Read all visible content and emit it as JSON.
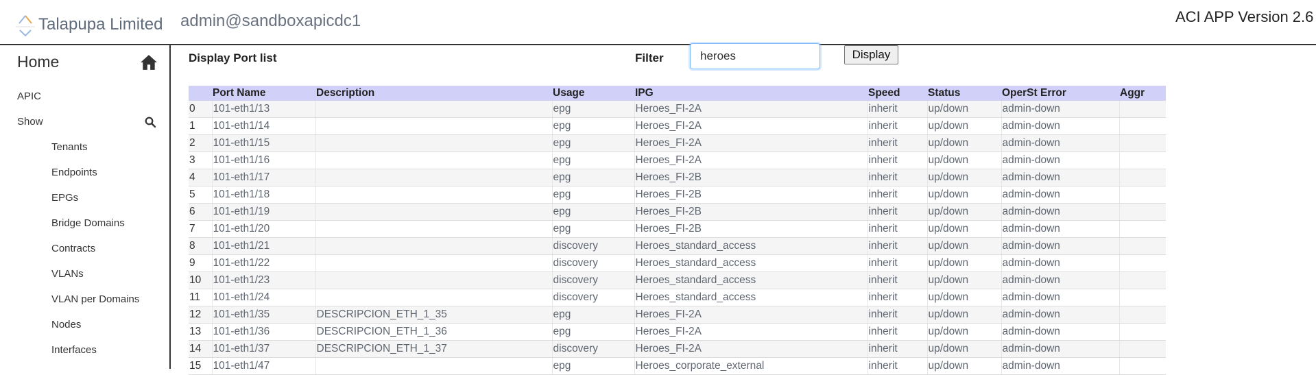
{
  "header": {
    "brand": "Talapupa Limited",
    "user": "admin@sandboxapicdc1",
    "version": "ACI APP Version 2.6"
  },
  "sidebar": {
    "home_label": "Home",
    "home_icon": "home-icon",
    "apic_label": "APIC",
    "show_label": "Show",
    "search_icon": "search-icon",
    "items": [
      "Tenants",
      "Endpoints",
      "EPGs",
      "Bridge Domains",
      "Contracts",
      "VLANs",
      "VLAN per Domains",
      "Nodes",
      "Interfaces"
    ]
  },
  "main": {
    "title": "Display Port list",
    "filter_label": "Filter",
    "filter_value": "heroes",
    "display_button": "Display",
    "columns": [
      "",
      "Port Name",
      "Description",
      "Usage",
      "IPG",
      "Speed",
      "Status",
      "OperSt Error",
      "Aggr"
    ],
    "rows": [
      [
        "0",
        "101-eth1/13",
        "",
        "epg",
        "Heroes_FI-2A",
        "inherit",
        "up/down",
        "admin-down",
        ""
      ],
      [
        "1",
        "101-eth1/14",
        "",
        "epg",
        "Heroes_FI-2A",
        "inherit",
        "up/down",
        "admin-down",
        ""
      ],
      [
        "2",
        "101-eth1/15",
        "",
        "epg",
        "Heroes_FI-2A",
        "inherit",
        "up/down",
        "admin-down",
        ""
      ],
      [
        "3",
        "101-eth1/16",
        "",
        "epg",
        "Heroes_FI-2A",
        "inherit",
        "up/down",
        "admin-down",
        ""
      ],
      [
        "4",
        "101-eth1/17",
        "",
        "epg",
        "Heroes_FI-2B",
        "inherit",
        "up/down",
        "admin-down",
        ""
      ],
      [
        "5",
        "101-eth1/18",
        "",
        "epg",
        "Heroes_FI-2B",
        "inherit",
        "up/down",
        "admin-down",
        ""
      ],
      [
        "6",
        "101-eth1/19",
        "",
        "epg",
        "Heroes_FI-2B",
        "inherit",
        "up/down",
        "admin-down",
        ""
      ],
      [
        "7",
        "101-eth1/20",
        "",
        "epg",
        "Heroes_FI-2B",
        "inherit",
        "up/down",
        "admin-down",
        ""
      ],
      [
        "8",
        "101-eth1/21",
        "",
        "discovery",
        "Heroes_standard_access",
        "inherit",
        "up/down",
        "admin-down",
        ""
      ],
      [
        "9",
        "101-eth1/22",
        "",
        "discovery",
        "Heroes_standard_access",
        "inherit",
        "up/down",
        "admin-down",
        ""
      ],
      [
        "10",
        "101-eth1/23",
        "",
        "discovery",
        "Heroes_standard_access",
        "inherit",
        "up/down",
        "admin-down",
        ""
      ],
      [
        "11",
        "101-eth1/24",
        "",
        "discovery",
        "Heroes_standard_access",
        "inherit",
        "up/down",
        "admin-down",
        ""
      ],
      [
        "12",
        "101-eth1/35",
        "DESCRIPCION_ETH_1_35",
        "epg",
        "Heroes_FI-2A",
        "inherit",
        "up/down",
        "admin-down",
        ""
      ],
      [
        "13",
        "101-eth1/36",
        "DESCRIPCION_ETH_1_36",
        "epg",
        "Heroes_FI-2A",
        "inherit",
        "up/down",
        "admin-down",
        ""
      ],
      [
        "14",
        "101-eth1/37",
        "DESCRIPCION_ETH_1_37",
        "discovery",
        "Heroes_FI-2A",
        "inherit",
        "up/down",
        "admin-down",
        ""
      ],
      [
        "15",
        "101-eth1/47",
        "",
        "epg",
        "Heroes_corporate_external",
        "inherit",
        "up/down",
        "admin-down",
        ""
      ]
    ]
  },
  "colors": {
    "table_header_bg": "#d0d0f8",
    "row_alt_bg": "#f5f5f5",
    "input_focus_border": "#80bdff"
  }
}
